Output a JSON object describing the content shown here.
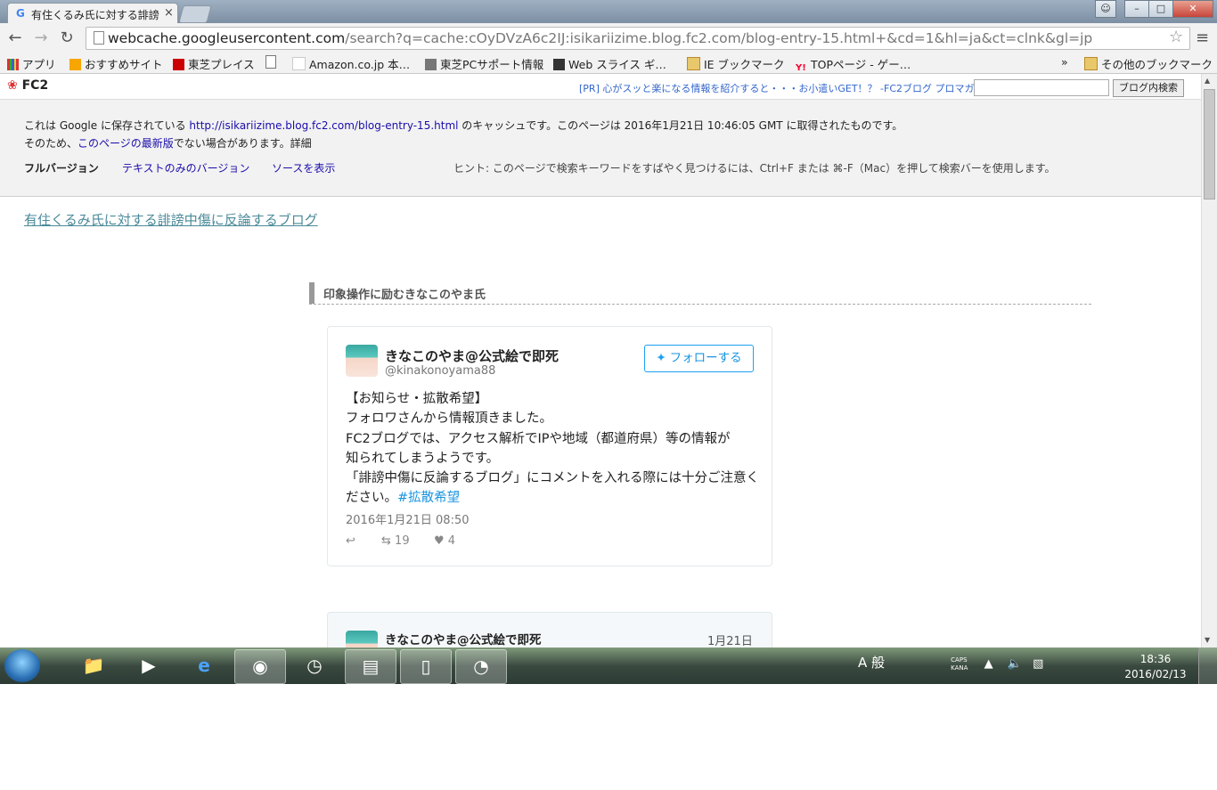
{
  "browser": {
    "tab_title": "有住くるみ氏に対する誹謗",
    "tab_close": "×",
    "url_host": "webcache.googleusercontent.com",
    "url_rest": "/search?q=cache:cOyDVzA6c2IJ:isikariizime.blog.fc2.com/blog-entry-15.html+&cd=1&hl=ja&ct=clnk&gl=jp",
    "bookmarks": [
      "アプリ",
      "おすすめサイト",
      "東芝プレイス",
      "Amazon.co.jp 本…",
      "東芝PCサポート情報",
      "Web スライス ギ…",
      "IE ブックマーク",
      "TOPページ - ゲー…"
    ],
    "bookmarks_more": "»",
    "other_bookmarks": "その他のブックマーク"
  },
  "fc2": {
    "logo": "FC2",
    "pr_text": "[PR] 心がスッと楽になる情報を紹介すると・・・お小遣いGET！？ -FC2ブログ プロマガ",
    "search_button": "ブログ内検索"
  },
  "cache": {
    "line1_pre": "これは Google に保存されている ",
    "line1_url": "http://isikariizime.blog.fc2.com/blog-entry-15.html",
    "line1_post": " のキャッシュです。このページは 2016年1月21日 10:46:05 GMT に取得されたものです。",
    "line2_pre": "そのため、",
    "line2_link": "このページの最新版",
    "line2_mid": "でない場合があります。",
    "line2_detail": "詳細",
    "full_version": "フルバージョン",
    "text_only": "テキストのみのバージョン",
    "view_source": "ソースを表示",
    "hint": "ヒント: このページで検索キーワードをすばやく見つけるには、Ctrl+F または ⌘-F（Mac）を押して検索バーを使用します。"
  },
  "blog": {
    "title": "有住くるみ氏に対する誹謗中傷に反論するブログ",
    "entry_title": "印象操作に励むきなこのやま氏"
  },
  "tweet1": {
    "name": "きなこのやま@公式絵で即死",
    "handle": "@kinakonoyama88",
    "follow": "フォローする",
    "lines": [
      "【お知らせ・拡散希望】",
      "フォロワさんから情報頂きました。",
      "FC2ブログでは、アクセス解析でIPや地域（都道府県）等の情報が",
      "知られてしまうようです。",
      "「誹謗中傷に反論するブログ」にコメントを入れる際には十分ご注意く"
    ],
    "last_line": "ださい。",
    "hashtag": "#拡散希望",
    "date": "2016年1月21日 08:50",
    "retweets": "19",
    "likes": "4"
  },
  "tweet2": {
    "name": "きなこのやま@公式絵で即死",
    "date": "1月21日"
  },
  "taskbar": {
    "ime": "A 般",
    "caps": "CAPS",
    "kana": "KANA",
    "time": "18:36",
    "date": "2016/02/13"
  }
}
